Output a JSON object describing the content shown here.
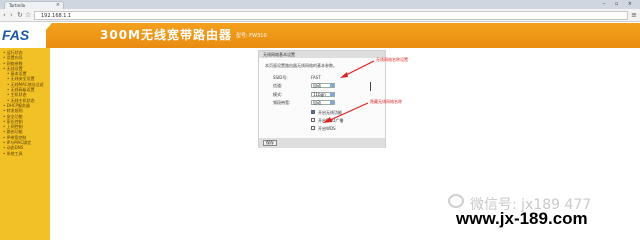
{
  "browser": {
    "tab_title": "Tartrello",
    "close_glyph": "×",
    "window_controls": "– ▫ ×",
    "url": "192.168.1.1",
    "back_glyph": "‹",
    "forward_glyph": "›",
    "reload_glyph": "↻",
    "home_glyph": "☆",
    "menu_glyph": "≡"
  },
  "header": {
    "logo": "FAST",
    "title": "300M无线宽带路由器",
    "model": "型号: FW310"
  },
  "sidebar": {
    "items": [
      {
        "label": "• 运行状态",
        "sub": false
      },
      {
        "label": "• 设置向导",
        "sub": false
      },
      {
        "label": "• 网络参数",
        "sub": false
      },
      {
        "label": "• 无线设置",
        "sub": false
      },
      {
        "label": "• 基本设置",
        "sub": true
      },
      {
        "label": "• 无线安全设置",
        "sub": true
      },
      {
        "label": "• 无线MAC地址过滤",
        "sub": true
      },
      {
        "label": "• 无线高级设置",
        "sub": true
      },
      {
        "label": "• 主机状态",
        "sub": true
      },
      {
        "label": "• 无线主机状态",
        "sub": true
      },
      {
        "label": "• DHCP服务器",
        "sub": false
      },
      {
        "label": "• 转发规则",
        "sub": false
      },
      {
        "label": "• 安全功能",
        "sub": false
      },
      {
        "label": "• 家长控制",
        "sub": false
      },
      {
        "label": "• 上网控制",
        "sub": false
      },
      {
        "label": "• 路由功能",
        "sub": false
      },
      {
        "label": "• IP带宽控制",
        "sub": false
      },
      {
        "label": "• IP与MAC绑定",
        "sub": false
      },
      {
        "label": "• 动态DNS",
        "sub": false
      },
      {
        "label": "• 系统工具",
        "sub": false
      }
    ]
  },
  "panel": {
    "title": "无线网络基本设置",
    "intro": "本页面设置路由器无线网络的基本参数。",
    "fields": {
      "ssid_label": "SSID号:",
      "ssid_value": "FAST",
      "region_label": "信道:",
      "region_value": "自动",
      "mode_label": "模式:",
      "mode_value": "11bgn",
      "bandwidth_label": "频段带宽:",
      "bandwidth_value": "自动"
    },
    "checkboxes": [
      {
        "label": "开启无线功能",
        "checked": true
      },
      {
        "label": "开启SSID广播",
        "checked": false
      },
      {
        "label": "开启WDS",
        "checked": false
      }
    ],
    "save_label": "保存"
  },
  "annotations": {
    "ssid_note": "无线网络名称设置",
    "broadcast_note": "隐藏无线网络名称"
  },
  "watermark": {
    "wechat": "微信号: jx189 477",
    "site": "www.jx-189.com"
  },
  "colors": {
    "header": "#ee9416",
    "sidebar": "#f2c126",
    "annotation": "#e02020"
  }
}
